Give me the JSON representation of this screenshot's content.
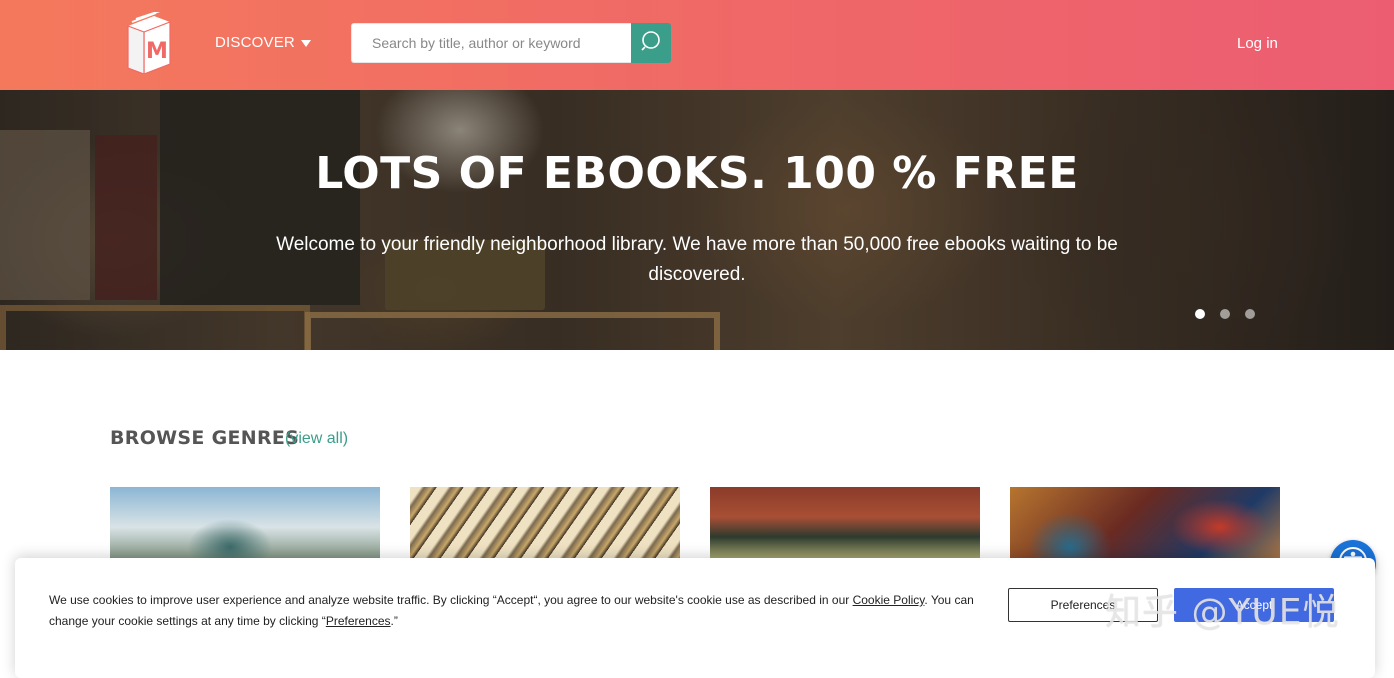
{
  "header": {
    "logo_letter": "M",
    "discover_label": "DISCOVER",
    "search_placeholder": "Search by title, author or keyword",
    "login_label": "Log in"
  },
  "hero": {
    "title": "LOTS OF EBOOKS. 100 % FREE",
    "subtitle": "Welcome to your friendly neighborhood library. We have more than 50,000 free ebooks waiting to be discovered.",
    "slides_total": 3,
    "active_slide": 1
  },
  "genres": {
    "title": "BROWSE GENRES",
    "view_all": "(view all)"
  },
  "cookie": {
    "text_before_policy": "We use cookies to improve user experience and analyze website traffic. By clicking “Accept“, you agree to our website's cookie use as described in our ",
    "policy_link": "Cookie Policy",
    "text_mid": ". You can change your cookie settings at any time by clicking “",
    "preferences_link": "Preferences",
    "text_end": ".”",
    "preferences_button": "Preferences",
    "accept_button": "Accept"
  },
  "watermark": "知乎 @YUE悦",
  "colors": {
    "header_gradient_start": "#f4795c",
    "header_gradient_end": "#ec5d72",
    "search_button": "#3a9e8a",
    "link_teal": "#3a9e8a",
    "accept_blue": "#4169e1",
    "accessibility_blue": "#1a73d9"
  },
  "icons": {
    "logo": "book-m-logo-icon",
    "search": "magnifier-icon",
    "discover_caret": "caret-down-icon",
    "accessibility": "accessibility-person-icon"
  }
}
